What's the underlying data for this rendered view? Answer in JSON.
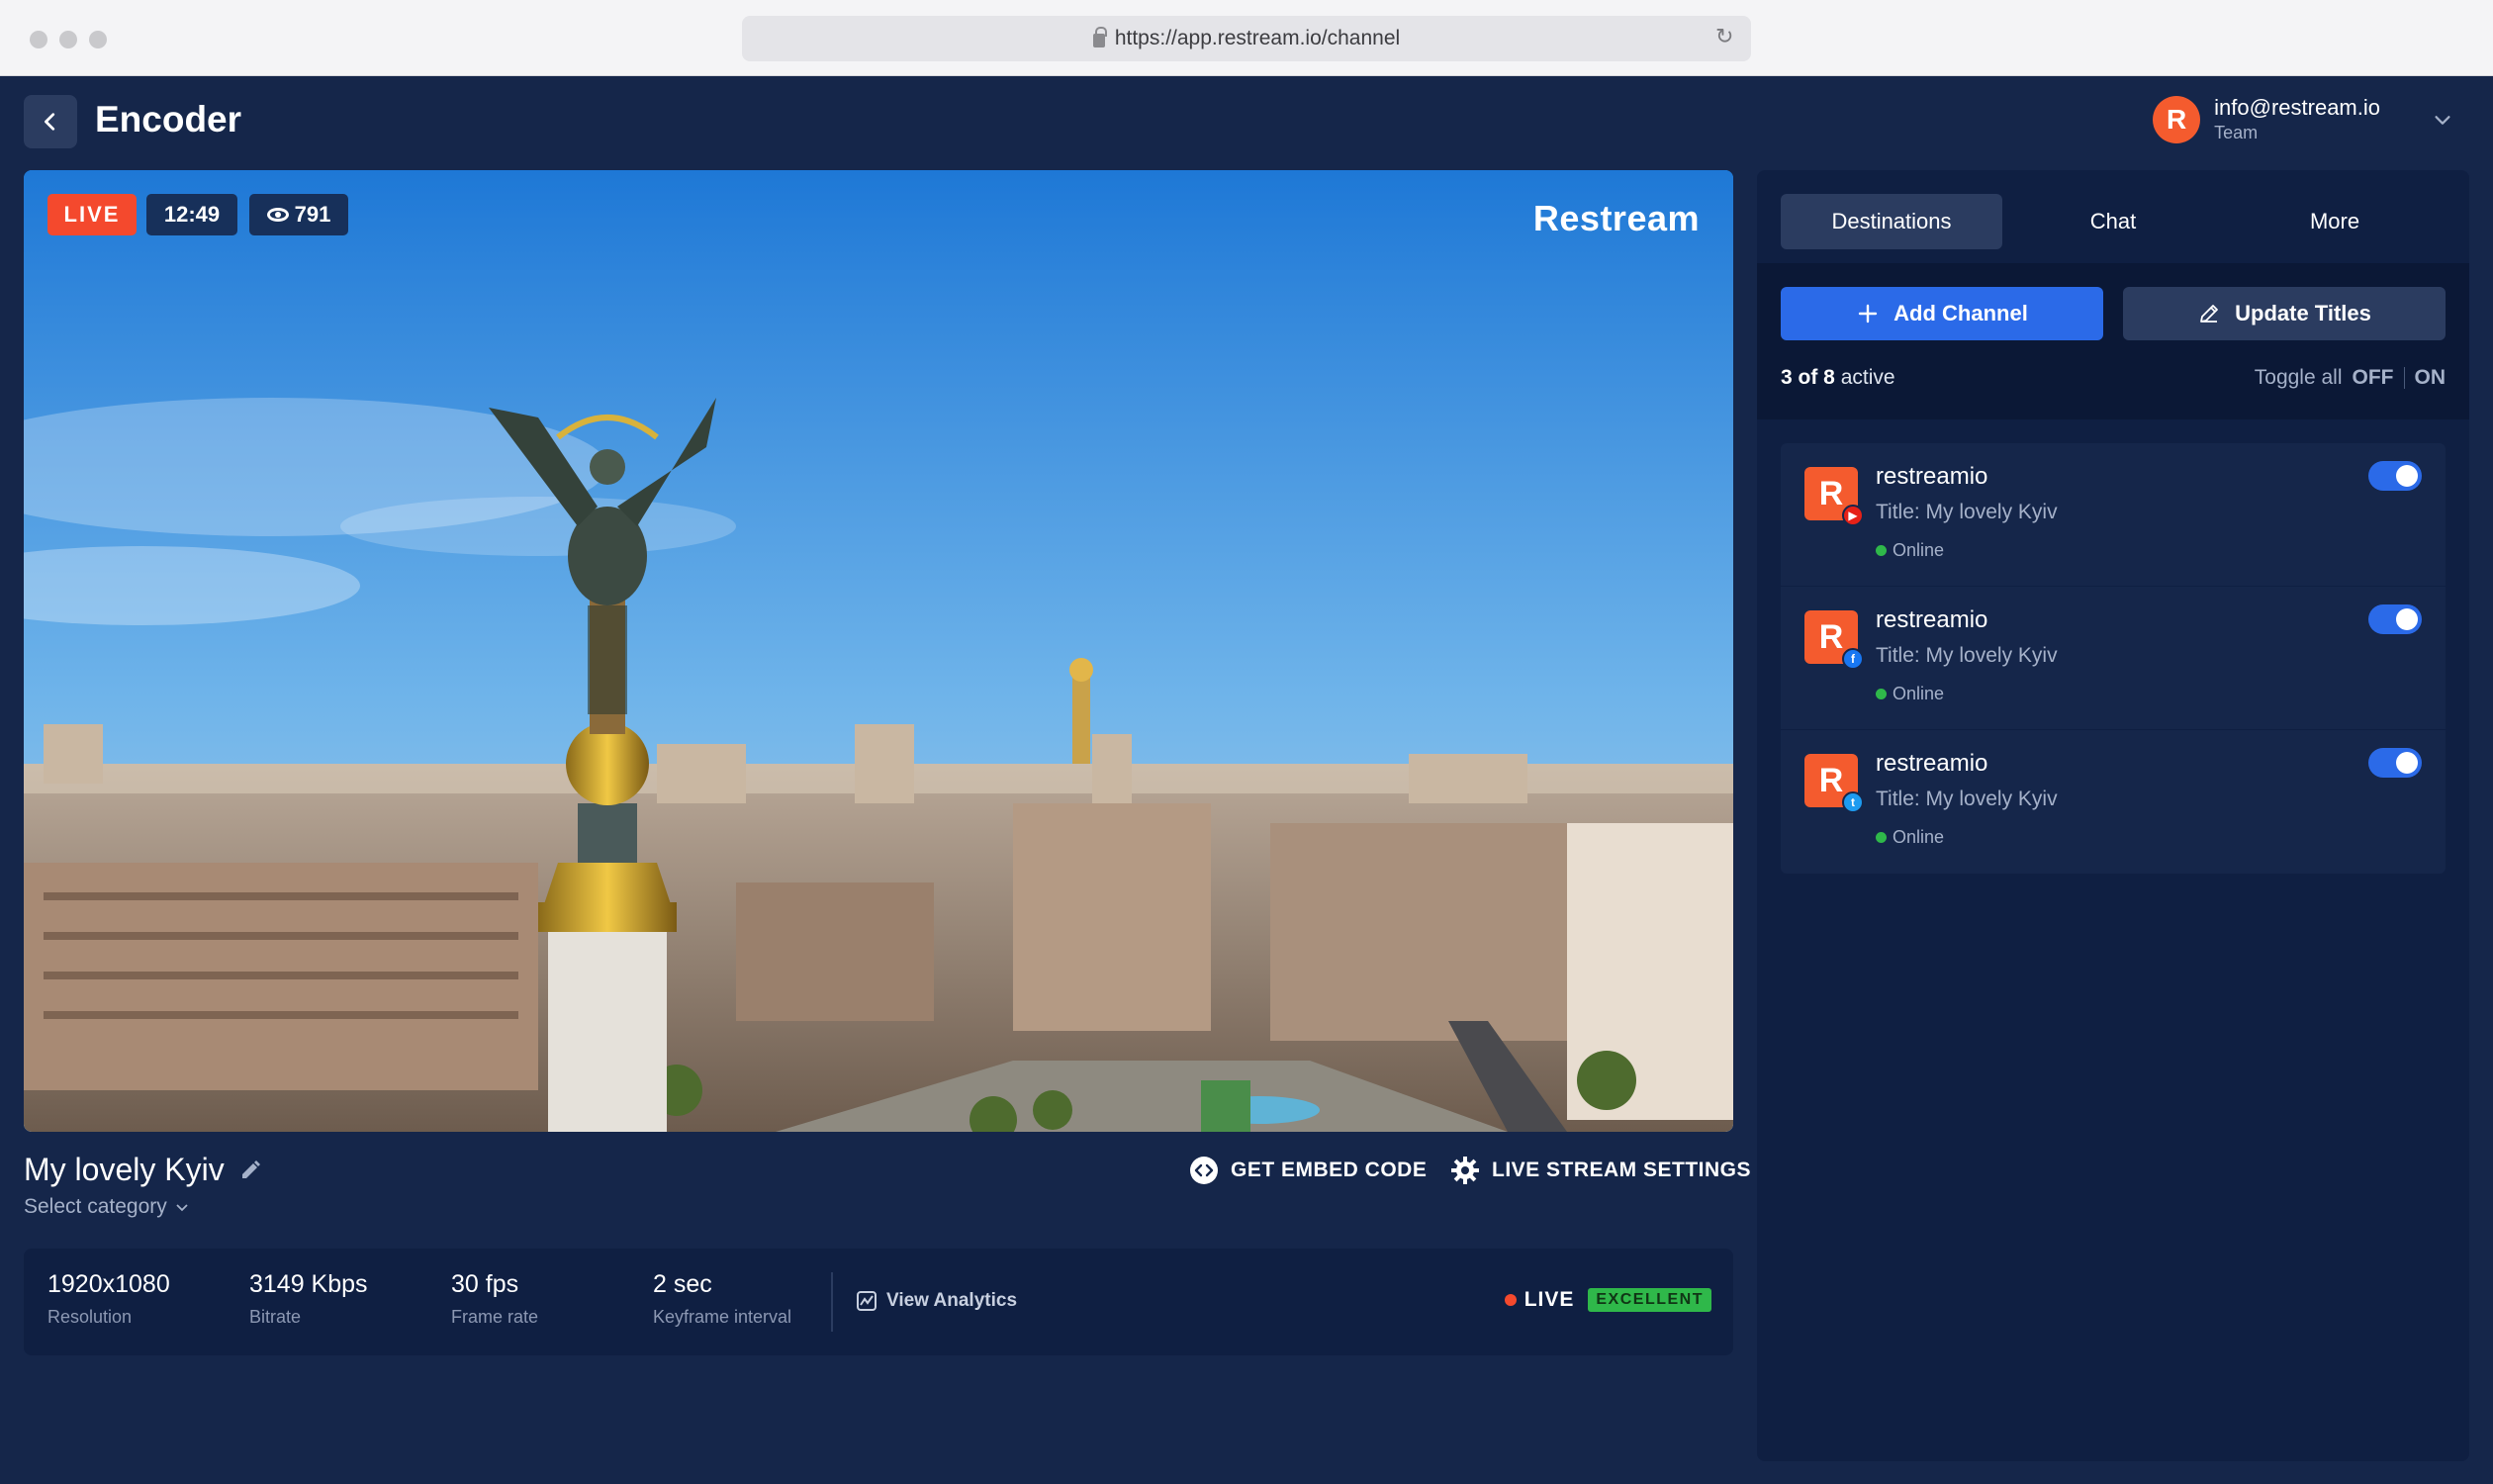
{
  "browser": {
    "url": "https://app.restream.io/channel"
  },
  "header": {
    "title": "Encoder",
    "account": {
      "avatar_letter": "R",
      "email": "info@restream.io",
      "role": "Team"
    }
  },
  "video": {
    "live_badge": "LIVE",
    "duration": "12:49",
    "viewers": "791",
    "watermark": "Restream"
  },
  "stream": {
    "title": "My lovely Kyiv",
    "category_placeholder": "Select category",
    "embed_label": "GET EMBED CODE",
    "settings_label": "LIVE STREAM SETTINGS"
  },
  "stats": {
    "items": [
      {
        "value": "1920x1080",
        "label": "Resolution"
      },
      {
        "value": "3149 Kbps",
        "label": "Bitrate"
      },
      {
        "value": "30 fps",
        "label": "Frame rate"
      },
      {
        "value": "2 sec",
        "label": "Keyframe interval"
      }
    ],
    "analytics_label": "View Analytics",
    "live_label": "LIVE",
    "quality_label": "EXCELLENT"
  },
  "panel": {
    "tabs": [
      {
        "label": "Destinations",
        "active": true
      },
      {
        "label": "Chat",
        "active": false
      },
      {
        "label": "More",
        "active": false
      }
    ],
    "add_channel_label": "Add Channel",
    "update_titles_label": "Update Titles",
    "active_count": "3 of 8",
    "active_suffix": "active",
    "toggle_all_label": "Toggle all",
    "toggle_off": "OFF",
    "toggle_on": "ON",
    "channels": [
      {
        "logo_letter": "R",
        "name": "restreamio",
        "title": "Title: My lovely Kyiv",
        "status": "Online",
        "platform_icon": "youtube-icon",
        "platform_color": "#e62117",
        "enabled": true
      },
      {
        "logo_letter": "R",
        "name": "restreamio",
        "title": "Title: My lovely Kyiv",
        "status": "Online",
        "platform_icon": "facebook-icon",
        "platform_color": "#1877f2",
        "enabled": true
      },
      {
        "logo_letter": "R",
        "name": "restreamio",
        "title": "Title: My lovely Kyiv",
        "status": "Online",
        "platform_icon": "twitter-icon",
        "platform_color": "#1d9bf0",
        "enabled": true
      }
    ]
  },
  "colors": {
    "background": "#15264a",
    "panel": "#0f1f42",
    "accent": "#2b6ae8",
    "live": "#f4492d",
    "brand": "#f45b2e",
    "success": "#2fb84a"
  }
}
